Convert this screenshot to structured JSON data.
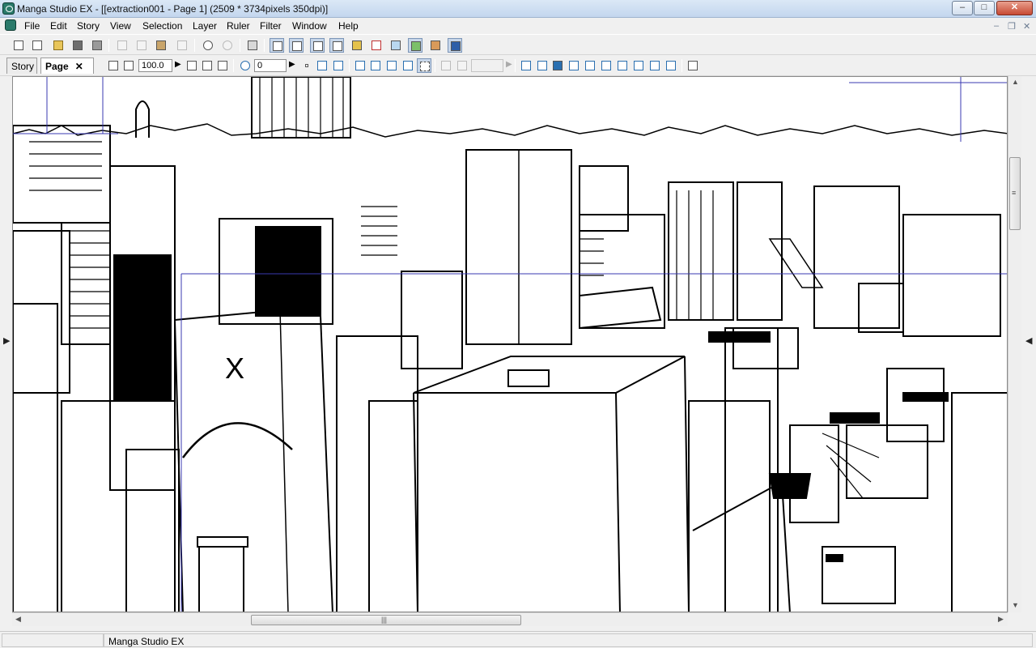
{
  "window": {
    "title": "Manga Studio EX - [[extraction001 - Page 1] (2509 * 3734pixels 350dpi)]",
    "controls": {
      "minimize": "–",
      "maximize": "□",
      "close": "✕"
    }
  },
  "menu": {
    "items": [
      "File",
      "Edit",
      "Story",
      "View",
      "Selection",
      "Layer",
      "Ruler",
      "Filter",
      "Window",
      "Help"
    ],
    "mdi_controls": {
      "minimize": "–",
      "restore": "❐",
      "close": "✕"
    }
  },
  "tabs": [
    {
      "label": "Story",
      "active": false
    },
    {
      "label": "Page",
      "active": true,
      "close": "✕"
    }
  ],
  "toolbar2": {
    "zoom_value": "100.0",
    "rotate_value": "0",
    "zoom_arrow": "▶",
    "rotate_arrow": "▶"
  },
  "canvas": {
    "document": "extraction001 - Page 1",
    "size": "2509 * 3734pixels",
    "resolution": "350dpi",
    "annotation_mark": "X"
  },
  "scrollbars": {
    "up": "▲",
    "down": "▼",
    "left": "◀",
    "right": "▶",
    "grip": "|||",
    "vgrip": "≡"
  },
  "side_handles": {
    "left": "▶",
    "right": "◀"
  },
  "status": {
    "text": "Manga Studio EX"
  },
  "colors": {
    "title_gradient": "#c3d6ee",
    "close_button": "#c74a34",
    "app_icon": "#2a7a6a",
    "guide_lines": "#3a3ab0",
    "ink": "#000000"
  }
}
